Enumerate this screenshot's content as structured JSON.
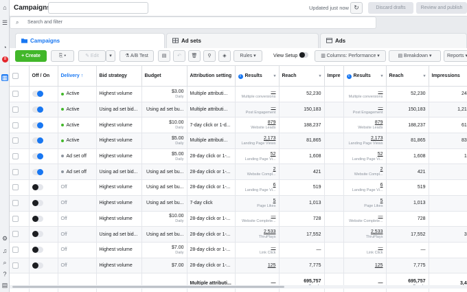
{
  "header": {
    "title": "Campaigns",
    "updated": "Updated just now",
    "discard_label": "Discard drafts",
    "review_label": "Review and publish"
  },
  "search": {
    "placeholder": "Search and filter"
  },
  "tabs": [
    {
      "label": "Campaigns",
      "icon": "folder-icon"
    },
    {
      "label": "Ad sets",
      "icon": "grid-icon"
    },
    {
      "label": "Ads",
      "icon": "ad-icon"
    }
  ],
  "notifications_count": "8",
  "toolbar": {
    "create": "+ Create",
    "edit": "Edit",
    "ab_test": "A/B Test",
    "rules": "Rules",
    "view_setup": "View Setup",
    "columns": "Columns: Performance",
    "breakdown": "Breakdown",
    "reports": "Reports"
  },
  "columns": [
    "Off / On",
    "Delivery",
    "Bid strategy",
    "Budget",
    "Attribution setting",
    "Results",
    "Reach",
    "Impre",
    "Results",
    "Reach",
    "Impressions"
  ],
  "rows": [
    {
      "on": true,
      "delivery": "Active",
      "status": "active",
      "bid": "Highest volume",
      "budget": "$3.00",
      "budget_sub": "Daily",
      "attr": "Multiple attributi...",
      "results": "—",
      "results_sub": "Multiple conversions",
      "reach": "52,230",
      "impr": "",
      "results2": "—",
      "results2_sub": "Multiple conversions",
      "reach2": "52,230",
      "impressions": "241,4"
    },
    {
      "on": true,
      "delivery": "Active",
      "status": "active",
      "bid": "Using ad set bid...",
      "budget": "Using ad set bu...",
      "budget_sub": "",
      "attr": "Multiple attributi...",
      "results": "—",
      "results_sub": "Post Engagement",
      "reach": "150,183",
      "impr": "",
      "results2": "—",
      "results2_sub": "Post Engagement",
      "reach2": "150,183",
      "impressions": "1,212,9"
    },
    {
      "on": true,
      "delivery": "Active",
      "status": "active",
      "bid": "Highest volume",
      "budget": "$10.00",
      "budget_sub": "Daily",
      "attr": "7-day click or 1-d...",
      "results": "879",
      "results_sub": "Website Leads",
      "reach": "188,237",
      "impr": "",
      "results2": "879",
      "results2_sub": "Website Leads",
      "reach2": "188,237",
      "impressions": "610,0"
    },
    {
      "on": true,
      "delivery": "Active",
      "status": "active",
      "bid": "Highest volume",
      "budget": "$5.00",
      "budget_sub": "Daily",
      "attr": "Multiple attributi...",
      "results": "2,173",
      "results_sub": "Landing Page Views",
      "reach": "81,865",
      "impr": "",
      "results2": "2,173",
      "results2_sub": "Landing Page Views",
      "reach2": "81,865",
      "impressions": "839,5"
    },
    {
      "on": true,
      "delivery": "Ad set off",
      "status": "off",
      "bid": "Highest volume",
      "budget": "$5.00",
      "budget_sub": "Daily",
      "attr": "28-day click or 1-...",
      "results": "52",
      "results_sub": "Landing Page Vi...",
      "reach": "1,608",
      "impr": "",
      "results2": "52",
      "results2_sub": "Landing Page Vi...",
      "reach2": "1,608",
      "impressions": "13,2"
    },
    {
      "on": true,
      "delivery": "Ad set off",
      "status": "off",
      "bid": "Using ad set bid...",
      "budget": "Using ad set bu...",
      "budget_sub": "",
      "attr": "28-day click or 1-...",
      "results": "2",
      "results_sub": "Website Compl...",
      "reach": "421",
      "impr": "",
      "results2": "2",
      "results2_sub": "Website Compl...",
      "reach2": "421",
      "impressions": "5,9"
    },
    {
      "on": false,
      "delivery": "Off",
      "status": "none",
      "bid": "Highest volume",
      "budget": "Using ad set bu...",
      "budget_sub": "",
      "attr": "28-day click or 1-...",
      "results": "6",
      "results_sub": "Landing Page Vi...",
      "reach": "519",
      "impr": "",
      "results2": "6",
      "results2_sub": "Landing Page Vi...",
      "reach2": "519",
      "impressions": "1,9"
    },
    {
      "on": false,
      "delivery": "Off",
      "status": "none",
      "bid": "Highest volume",
      "budget": "Using ad set bu...",
      "budget_sub": "",
      "attr": "7-day click",
      "results": "5",
      "results_sub": "Page Likes",
      "reach": "1,013",
      "impr": "",
      "results2": "5",
      "results2_sub": "Page Likes",
      "reach2": "1,013",
      "impressions": "7,9"
    },
    {
      "on": false,
      "delivery": "Off",
      "status": "none",
      "bid": "Highest volume",
      "budget": "$10.00",
      "budget_sub": "Daily",
      "attr": "28-day click or 1-...",
      "results": "—",
      "results_sub": "Website Complete...",
      "reach": "728",
      "impr": "",
      "results2": "—",
      "results2_sub": "Website Complete...",
      "reach2": "728",
      "impressions": "1,6"
    },
    {
      "on": false,
      "delivery": "Off",
      "status": "none",
      "bid": "Using ad set bid...",
      "budget": "Using ad set bu...",
      "budget_sub": "",
      "attr": "28-day click or 1-...",
      "results": "2,533",
      "results_sub": "ThruPlays",
      "reach": "17,552",
      "impr": "",
      "results2": "2,533",
      "results2_sub": "ThruPlays",
      "reach2": "17,552",
      "impressions": "31,6"
    },
    {
      "on": false,
      "delivery": "Off",
      "status": "none",
      "bid": "Highest volume",
      "budget": "$7.00",
      "budget_sub": "Daily",
      "attr": "28-day click or 1-...",
      "results": "—",
      "results_sub": "Link Click",
      "reach": "—",
      "impr": "",
      "results2": "—",
      "results2_sub": "Link Click",
      "reach2": "—",
      "impressions": ""
    },
    {
      "on": false,
      "delivery": "Off",
      "status": "none",
      "bid": "Highest volume",
      "budget": "$7.00",
      "budget_sub": "",
      "attr": "28-day click or 1-...",
      "results": "125",
      "results_sub": "",
      "reach": "7,775",
      "impr": "",
      "results2": "125",
      "results2_sub": "",
      "reach2": "7,775",
      "impressions": ""
    }
  ],
  "totals": {
    "attr": "Multiple attributi...",
    "results": "—",
    "reach": "695,757",
    "reach_sub": "People",
    "results2": "—",
    "reach2": "695,757",
    "reach2_sub": "People",
    "impressions": "3,436,"
  }
}
